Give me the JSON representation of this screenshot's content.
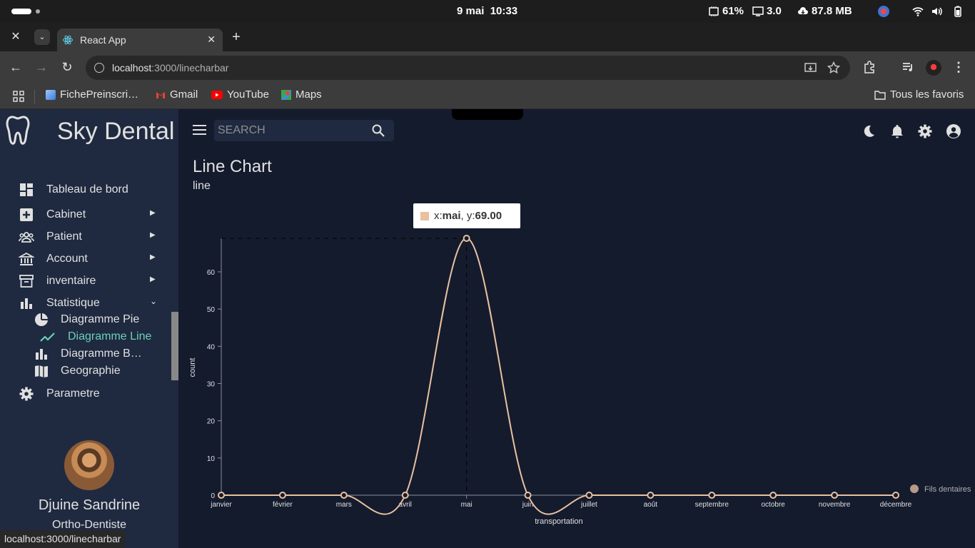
{
  "os": {
    "date": "9 mai",
    "time": "10:33",
    "cpu": "61%",
    "load": "3.0",
    "network": "87.8 MB"
  },
  "browser": {
    "tab_title": "React App",
    "url_host": "localhost",
    "url_path": ":3000/linecharbar",
    "bookmarks": [
      "FichePreinscri…",
      "Gmail",
      "YouTube",
      "Maps"
    ],
    "all_bookmarks": "Tous les favoris",
    "status_url": "localhost:3000/linecharbar"
  },
  "app": {
    "name": "Sky Dental",
    "search_placeholder": "SEARCH",
    "menu": [
      {
        "label": "Tableau de bord",
        "icon": "dashboard-icon"
      },
      {
        "label": "Cabinet",
        "icon": "plus-box-icon"
      },
      {
        "label": "Patient",
        "icon": "people-icon"
      },
      {
        "label": "Account",
        "icon": "bank-icon"
      },
      {
        "label": "inventaire",
        "icon": "archive-icon"
      },
      {
        "label": "Statistique",
        "icon": "bar-chart-icon"
      },
      {
        "label": "Parametre",
        "icon": "gear-icon"
      }
    ],
    "submenu": [
      {
        "label": "Diagramme Pie",
        "icon": "pie-chart-icon"
      },
      {
        "label": "Diagramme Line",
        "icon": "line-chart-icon",
        "active": true
      },
      {
        "label": "Diagramme B…",
        "icon": "bar-chart-icon"
      },
      {
        "label": "Geographie",
        "icon": "map-icon"
      }
    ],
    "user": {
      "name": "Djuine Sandrine",
      "role": "Ortho-Dentiste"
    },
    "active_color": "#6ad0b8"
  },
  "page": {
    "title": "Line Chart",
    "subtitle": "line"
  },
  "tooltip": {
    "x_prefix": "x: ",
    "x_value": "mai",
    "y_prefix": ", y: ",
    "y_value": "69.00"
  },
  "chart_data": {
    "type": "line",
    "x": [
      "janvier",
      "février",
      "mars",
      "avril",
      "mai",
      "juin",
      "juillet",
      "août",
      "septembre",
      "octobre",
      "novembre",
      "décembre"
    ],
    "series": [
      {
        "name": "Fils dentaires",
        "values": [
          0,
          0,
          0,
          0,
          69,
          0,
          0,
          0,
          0,
          0,
          0,
          0
        ],
        "color": "#e8c1a0"
      }
    ],
    "xlabel": "transportation",
    "ylabel": "count",
    "yticks": [
      0,
      10,
      20,
      30,
      40,
      50,
      60
    ],
    "ylim": [
      0,
      69
    ],
    "legend_position": "right",
    "grid": false
  }
}
